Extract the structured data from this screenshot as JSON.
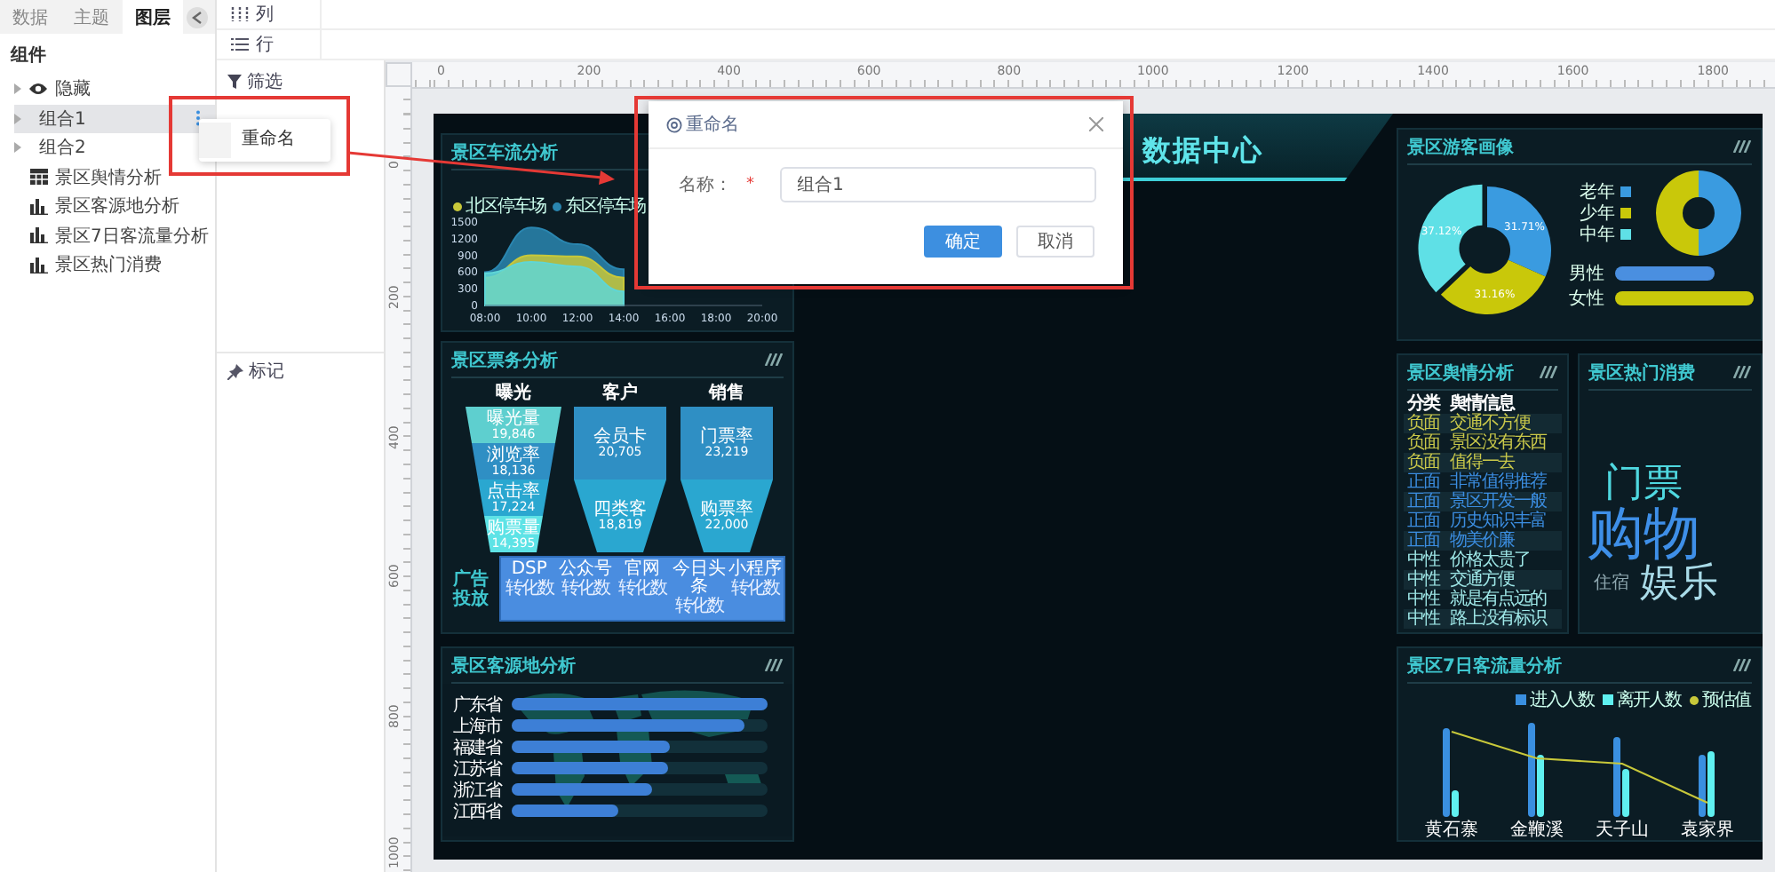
{
  "sidebar": {
    "tabs": [
      {
        "label": "数据",
        "selected": false
      },
      {
        "label": "主题",
        "selected": false
      },
      {
        "label": "图层",
        "selected": true
      }
    ],
    "section_title": "组件",
    "layers": [
      {
        "label": "隐藏",
        "kind": "hidden",
        "selected": false
      },
      {
        "label": "组合1",
        "kind": "group",
        "selected": true
      },
      {
        "label": "组合2",
        "kind": "group",
        "selected": false
      },
      {
        "label": "景区舆情分析",
        "kind": "table",
        "selected": false
      },
      {
        "label": "景区客源地分析",
        "kind": "chart",
        "selected": false
      },
      {
        "label": "景区7日客流量分析",
        "kind": "chart",
        "selected": false
      },
      {
        "label": "景区热门消费",
        "kind": "chart",
        "selected": false
      }
    ]
  },
  "shelves": [
    {
      "label": "列",
      "kind": "columns"
    },
    {
      "label": "行",
      "kind": "rows"
    }
  ],
  "cards": [
    {
      "label": "筛选",
      "kind": "filter"
    },
    {
      "label": "标记",
      "kind": "marks"
    }
  ],
  "rulers": {
    "horizontal": [
      "0",
      "200",
      "400",
      "600",
      "800",
      "1000",
      "1200",
      "1400",
      "1600",
      "1800"
    ],
    "vertical": [
      "0",
      "200",
      "400",
      "600",
      "800",
      "1000"
    ]
  },
  "dashboard": {
    "title": "数据中心",
    "traffic": {
      "title": "景区车流分析",
      "chart_data": {
        "type": "area",
        "x": [
          "08:00",
          "10:00",
          "12:00",
          "14:00",
          "16:00",
          "18:00",
          "20:00"
        ],
        "ylim": [
          0,
          1500
        ],
        "yticks": [
          0,
          300,
          600,
          900,
          1200,
          1500
        ],
        "series": [
          {
            "name": "北区停车场",
            "color": "#c8c83a",
            "values": [
              500,
              900,
              880,
              500,
              null,
              null,
              null
            ]
          },
          {
            "name": "东区停车场",
            "color": "#2a86b0",
            "values": [
              600,
              1400,
              1100,
              650,
              null,
              null,
              null
            ]
          },
          {
            "color": "#5fd6d6",
            "values": [
              580,
              780,
              700,
              250,
              null,
              null,
              null
            ]
          }
        ]
      }
    },
    "ticket": {
      "title": "景区票务分析",
      "funnels": [
        {
          "title": "曝光",
          "stages": [
            {
              "name": "曝光量",
              "value": "19,846",
              "color": "#5ecfcf"
            },
            {
              "name": "浏览率",
              "value": "18,136",
              "color": "#2f8fc4"
            },
            {
              "name": "点击率",
              "value": "17,224",
              "color": "#2aa7d0"
            },
            {
              "name": "购票量",
              "value": "14,395",
              "color": "#5ee3e6"
            }
          ]
        },
        {
          "title": "客户",
          "stages": [
            {
              "name": "会员卡",
              "value": "20,705",
              "color": "#2f8fc4"
            },
            {
              "name": "四类客",
              "value": "18,819",
              "color": "#2aa7d0"
            }
          ]
        },
        {
          "title": "销售",
          "stages": [
            {
              "name": "门票率",
              "value": "23,219",
              "color": "#2f8fc4"
            },
            {
              "name": "购票率",
              "value": "22,000",
              "color": "#2aa7d0"
            }
          ]
        }
      ],
      "channels_label": "广告投放",
      "channels": [
        {
          "name": "DSP",
          "note": "转化数"
        },
        {
          "name": "公众号",
          "note": "转化数"
        },
        {
          "name": "官网",
          "note": "转化数"
        },
        {
          "name": "今日头条",
          "note": "转化数"
        },
        {
          "name": "小程序",
          "note": "转化数"
        }
      ]
    },
    "source": {
      "title": "景区客源地分析",
      "bars": [
        {
          "label": "广东省",
          "level": 1.0
        },
        {
          "label": "上海市",
          "level": 0.91
        },
        {
          "label": "福建省",
          "level": 0.62
        },
        {
          "label": "江苏省",
          "level": 0.61
        },
        {
          "label": "浙江省",
          "level": 0.55
        },
        {
          "label": "江西省",
          "level": 0.42
        }
      ]
    },
    "profile": {
      "title": "景区游客画像",
      "chart_data": {
        "type": "donut",
        "categories": [
          "老年",
          "少年",
          "中年"
        ],
        "values": [
          31.71,
          31.16,
          37.12
        ],
        "colors": [
          "#3a9be0",
          "#c9c80a",
          "#5fe0e6"
        ],
        "value_labels": [
          "31.71%",
          "31.16%",
          "37.12%"
        ]
      },
      "genders": [
        {
          "label": "男性",
          "level": 0.72,
          "color": "#4a8fe0"
        },
        {
          "label": "女性",
          "level": 1.0,
          "color": "#c9c80a"
        }
      ]
    },
    "sentiment": {
      "title": "景区舆情分析",
      "columns": [
        "分类",
        "舆情信息"
      ],
      "rows": [
        {
          "category": "负面",
          "text": "交通不方便",
          "color": "#c9c84a"
        },
        {
          "category": "负面",
          "text": "景区没有东西",
          "color": "#c9c84a"
        },
        {
          "category": "负面",
          "text": "值得一去",
          "color": "#c9c84a"
        },
        {
          "category": "正面",
          "text": "非常值得推荐",
          "color": "#3b8de0"
        },
        {
          "category": "正面",
          "text": "景区开发一般",
          "color": "#3b8de0"
        },
        {
          "category": "正面",
          "text": "历史知识丰富",
          "color": "#3b8de0"
        },
        {
          "category": "正面",
          "text": "物美价廉",
          "color": "#3b8de0"
        },
        {
          "category": "中性",
          "text": "价格太贵了",
          "color": "#9fe8e8"
        },
        {
          "category": "中性",
          "text": "交通方便",
          "color": "#9fe8e8"
        },
        {
          "category": "中性",
          "text": "就是有点远的",
          "color": "#9fe8e8"
        },
        {
          "category": "中性",
          "text": "路上没有标识",
          "color": "#9fe8e8"
        }
      ]
    },
    "hot": {
      "title": "景区热门消费",
      "words": [
        {
          "text": "门票",
          "color": "#4fd8e0"
        },
        {
          "text": "购物",
          "color": "#3e8fe8"
        },
        {
          "text": "住宿",
          "color": "#8fa8b0"
        },
        {
          "text": "娱乐",
          "color": "#a9dbe8"
        }
      ]
    },
    "week": {
      "title": "景区7日客流量分析",
      "legend": [
        {
          "label": "进入人数",
          "color": "#3a8fe0",
          "kind": "bar"
        },
        {
          "label": "离开人数",
          "color": "#5ff0f0",
          "kind": "bar"
        },
        {
          "label": "预估值",
          "color": "#c8c83a",
          "kind": "line"
        }
      ],
      "categories": [
        "黄石寨",
        "金鞭溪",
        "天子山",
        "袁家界"
      ]
    }
  },
  "context_menu": {
    "items": [
      "重命名"
    ]
  },
  "dialog": {
    "title": "重命名",
    "field_label": "名称：",
    "required_mark": "*",
    "value": "组合1",
    "buttons": [
      {
        "label": "确定",
        "kind": "primary"
      },
      {
        "label": "取消",
        "kind": "default"
      }
    ]
  }
}
